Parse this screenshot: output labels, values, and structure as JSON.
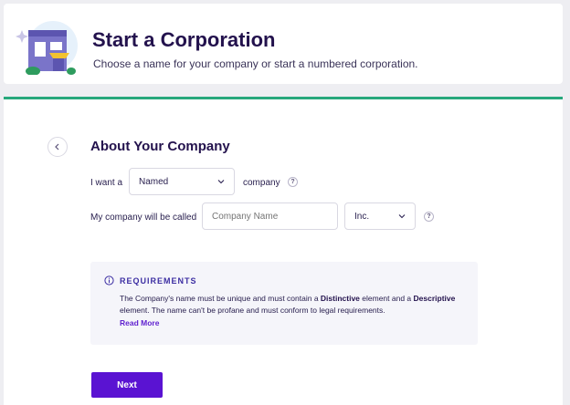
{
  "header": {
    "title": "Start a Corporation",
    "subtitle": "Choose a name for your company or start a numbered corporation."
  },
  "section": {
    "title": "About Your Company"
  },
  "form": {
    "row1": {
      "prefix": "I want a",
      "type_value": "Named",
      "suffix": "company",
      "help": "?"
    },
    "row2": {
      "label": "My company will be called",
      "name_placeholder": "Company Name",
      "name_value": "",
      "suffix_value": "Inc.",
      "help": "?"
    }
  },
  "requirements": {
    "title": "REQUIREMENTS",
    "text_a": "The Company's name must be unique and must contain a ",
    "text_b": "Distinctive",
    "text_c": " element and a ",
    "text_d": "Descriptive",
    "text_e": " element. The name can't be profane and must conform to legal requirements.",
    "read_more": "Read More"
  },
  "actions": {
    "next": "Next"
  },
  "colors": {
    "accent": "#5a13d2",
    "divider": "#27a87c",
    "title": "#23124d"
  }
}
